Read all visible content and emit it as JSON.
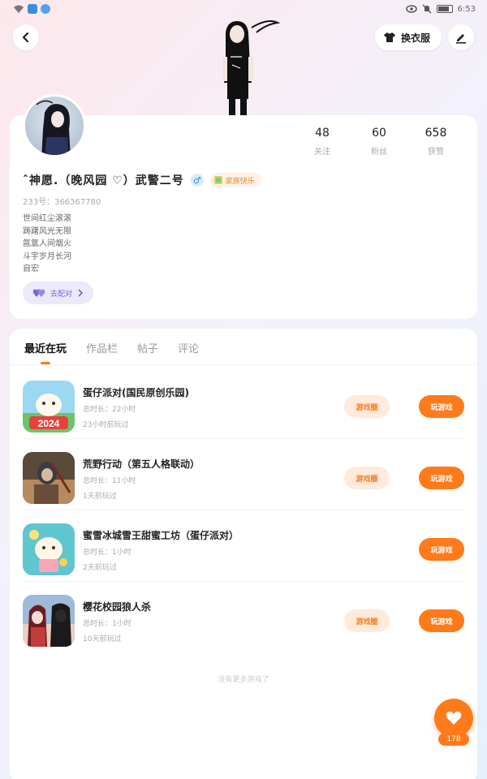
{
  "status_bar": {
    "time": "6:53"
  },
  "header": {
    "dress_label": "换衣服"
  },
  "profile": {
    "stats": [
      {
        "value": "48",
        "label": "关注"
      },
      {
        "value": "60",
        "label": "粉丝"
      },
      {
        "value": "658",
        "label": "获赞"
      }
    ],
    "nickname": "ˆ神愿.（晚风园 ♡）武警二号",
    "gender_symbol": "♂",
    "tag_label": "家族快乐",
    "uid": "233号：366367780",
    "bio": [
      "世间红尘滚滚",
      "踌躇风光无限",
      "氤氲人间烟火",
      "斗宇岁月长河",
      "自宏"
    ],
    "pair_button": "去配对"
  },
  "tabs": [
    "最近在玩",
    "作品栏",
    "帖子",
    "评论"
  ],
  "games": [
    {
      "name": "蛋仔派对(国民原创乐园)",
      "total": "总时长：22小时",
      "last": "23小时前玩过",
      "circle_label": "游戏圈",
      "play_label": "玩游戏",
      "has_circle": true,
      "icon": "eggy-party-2024-icon"
    },
    {
      "name": "荒野行动（第五人格联动）",
      "total": "总时长：11小时",
      "last": "1天前玩过",
      "circle_label": "游戏圈",
      "play_label": "玩游戏",
      "has_circle": true,
      "icon": "knives-out-icon"
    },
    {
      "name": "蜜雪冰城雪王甜蜜工坊（蛋仔派对）",
      "total": "总时长：1小时",
      "last": "2天前玩过",
      "circle_label": "",
      "play_label": "玩游戏",
      "has_circle": false,
      "icon": "mixue-eggy-icon"
    },
    {
      "name": "樱花校园狼人杀",
      "total": "总时长：1小时",
      "last": "10天前玩过",
      "circle_label": "游戏圈",
      "play_label": "玩游戏",
      "has_circle": true,
      "icon": "sakura-werewolf-icon"
    }
  ],
  "list_end": "没有更多游戏了",
  "fab": {
    "count": "178"
  },
  "colors": {
    "accent": "#ff7a1a",
    "accent_light": "#ffeadb",
    "purple": "#7a5fe0"
  }
}
